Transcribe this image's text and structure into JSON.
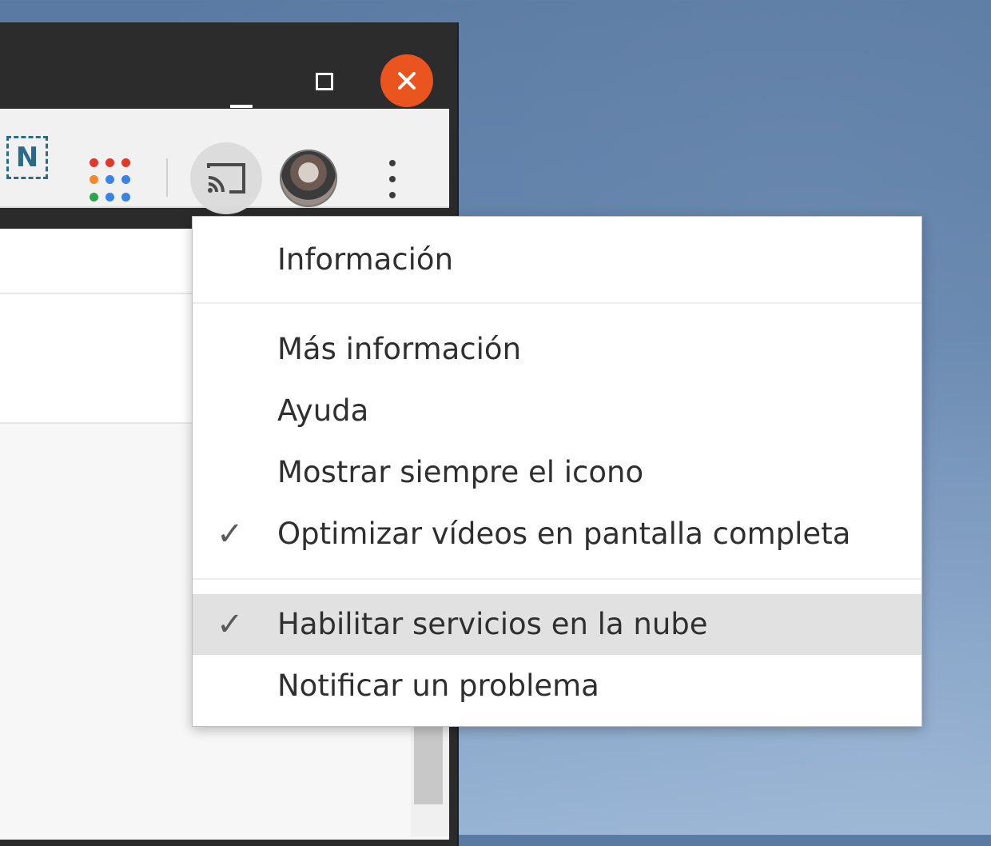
{
  "window": {
    "controls": {
      "minimize_icon": "minimize-icon",
      "maximize_icon": "maximize-icon",
      "close_glyph": "✕"
    }
  },
  "toolbar": {
    "extension_n_label": "N",
    "apps_dot_colors": [
      "#e0392b",
      "#e0392b",
      "#e0392b",
      "#f08a2c",
      "#3b82e6",
      "#3b82e6",
      "#2da44e",
      "#3b82e6",
      "#3b82e6"
    ],
    "cast_icon": "cast-icon",
    "avatar_icon": "profile-avatar",
    "menu_icon": "vertical-dots-icon"
  },
  "menu": {
    "header": "Información",
    "items": [
      {
        "label": "Más información",
        "checked": false
      },
      {
        "label": "Ayuda",
        "checked": false
      },
      {
        "label": "Mostrar siempre el icono",
        "checked": false
      },
      {
        "label": "Optimizar vídeos en pantalla completa",
        "checked": true,
        "check_glyph": "✓"
      }
    ],
    "items2": [
      {
        "label": "Habilitar servicios en la nube",
        "checked": true,
        "check_glyph": "✓",
        "highlighted": true
      },
      {
        "label": "Notificar un problema",
        "checked": false
      }
    ]
  },
  "colors": {
    "close_button": "#e9541f",
    "titlebar": "#2c2c2c",
    "menu_highlight": "#e1e1e1",
    "desktop": "#6283ad"
  }
}
